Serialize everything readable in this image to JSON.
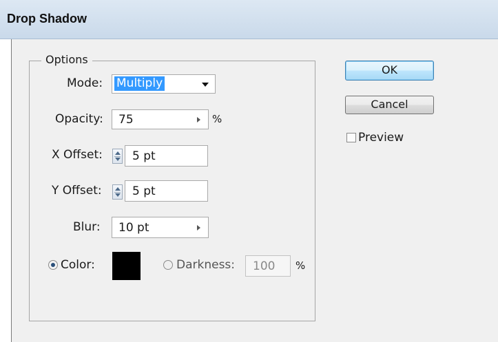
{
  "window": {
    "title": "Drop Shadow"
  },
  "options_group": {
    "label": "Options"
  },
  "mode": {
    "label": "Mode:",
    "value": "Multiply"
  },
  "opacity": {
    "label": "Opacity:",
    "value": "75",
    "unit": "%"
  },
  "x_offset": {
    "label": "X Offset:",
    "value": "5 pt"
  },
  "y_offset": {
    "label": "Y Offset:",
    "value": "5 pt"
  },
  "blur": {
    "label": "Blur:",
    "value": "10 pt"
  },
  "color_option": {
    "label": "Color:",
    "selected": true,
    "swatch": "#000000"
  },
  "darkness_option": {
    "label": "Darkness:",
    "selected": false,
    "value": "100",
    "unit": "%"
  },
  "buttons": {
    "ok": "OK",
    "cancel": "Cancel"
  },
  "preview": {
    "label": "Preview",
    "checked": false
  },
  "colors": {
    "selection_highlight": "#3399ff",
    "ok_button": "#bee6fd"
  }
}
